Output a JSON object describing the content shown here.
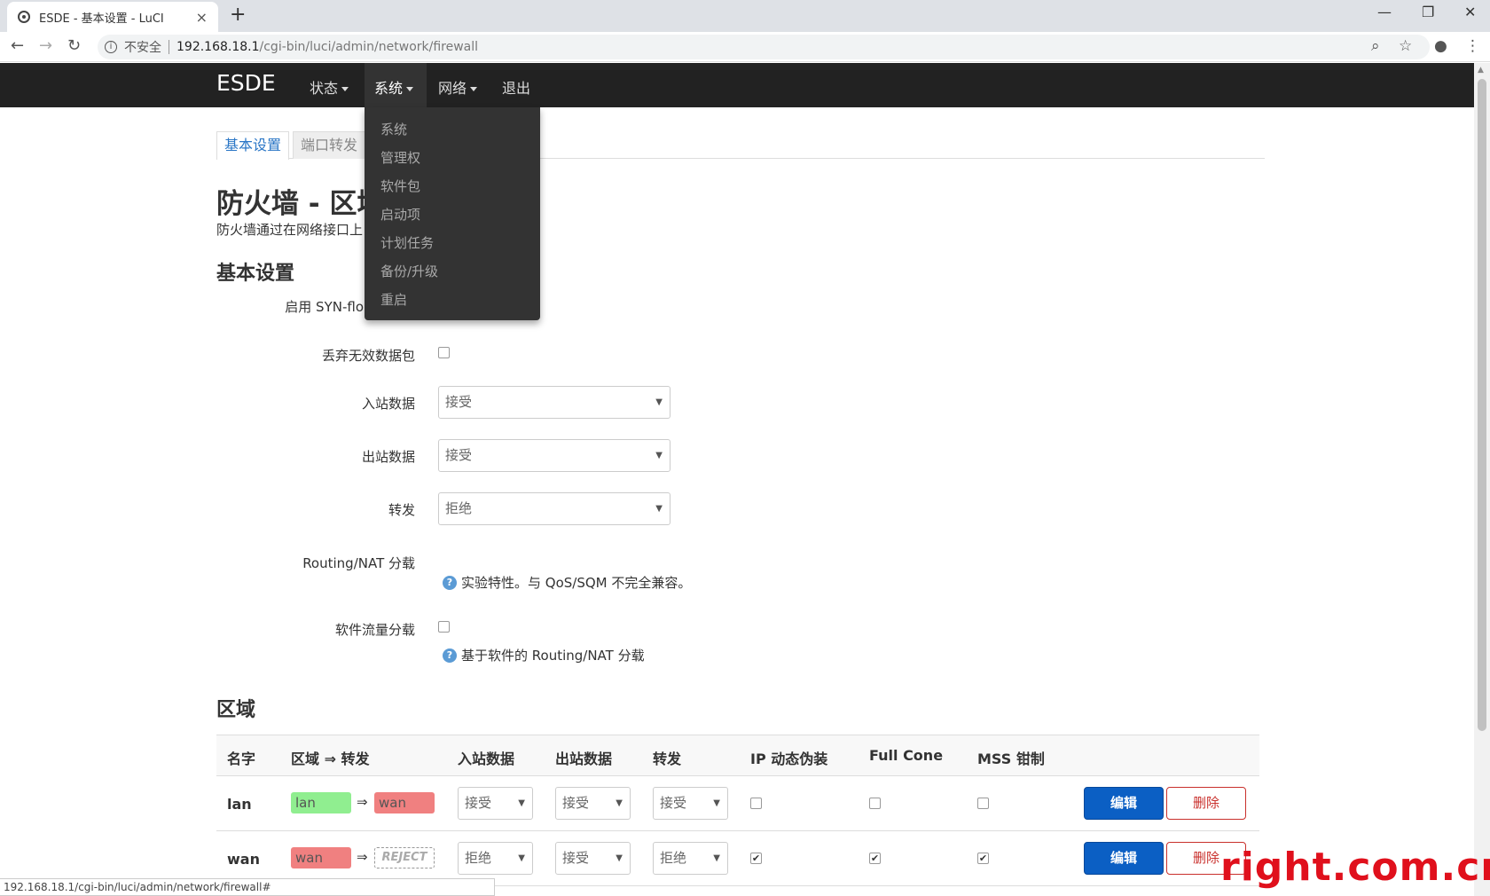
{
  "browser": {
    "tab_title": "ESDE - 基本设置 - LuCI",
    "tab_close": "×",
    "new_tab": "+",
    "insecure_label": "不安全",
    "url_host": "192.168.18.1",
    "url_path": "/cgi-bin/luci/admin/network/firewall",
    "status_url": "192.168.18.1/cgi-bin/luci/admin/network/firewall#"
  },
  "navbar": {
    "brand": "ESDE",
    "menus": [
      {
        "label": "状态"
      },
      {
        "label": "系统"
      },
      {
        "label": "网络"
      },
      {
        "label": "退出"
      }
    ],
    "dropdown": [
      "系统",
      "管理权",
      "软件包",
      "启动项",
      "计划任务",
      "备份/升级",
      "重启"
    ]
  },
  "page_tabs": [
    "基本设置",
    "端口转发"
  ],
  "title": "防火墙 - 区域",
  "description": "防火墙通过在网络接口上",
  "general": {
    "heading": "基本设置",
    "syn_flood_label": "启用 SYN-flo",
    "drop_invalid_label": "丢弃无效数据包",
    "input_label": "入站数据",
    "input_value": "接受",
    "output_label": "出站数据",
    "output_value": "接受",
    "forward_label": "转发",
    "forward_value": "拒绝",
    "offload_label": "Routing/NAT 分载",
    "offload_help": "实验特性。与 QoS/SQM 不完全兼容。",
    "sw_offload_label": "软件流量分载",
    "sw_offload_help": "基于软件的 Routing/NAT 分载"
  },
  "zones": {
    "heading": "区域",
    "columns": [
      "名字",
      "区域 ⇒ 转发",
      "入站数据",
      "出站数据",
      "转发",
      "IP 动态伪装",
      "Full Cone",
      "MSS 钳制"
    ],
    "arrow": "⇒",
    "rows": [
      {
        "name": "lan",
        "zone": "lan",
        "forward": "wan",
        "input": "接受",
        "output": "接受",
        "fwd": "接受",
        "masq": false,
        "fullcone": false,
        "mss": false,
        "edit": "编辑",
        "delete": "删除"
      },
      {
        "name": "wan",
        "zone": "wan",
        "forward": "REJECT",
        "input": "拒绝",
        "output": "接受",
        "fwd": "拒绝",
        "masq": true,
        "fullcone": true,
        "mss": true,
        "edit": "编辑",
        "delete": "删除"
      }
    ]
  },
  "colors": {
    "lan_zone": "#90ee90",
    "wan_zone": "#f08080",
    "edit_button": "#0b5fc4",
    "delete_button": "#c9302c",
    "navbar": "#222222",
    "watermark": "#e0101c"
  },
  "icons": {
    "help": "question-circle-icon",
    "checked": "checkmark-icon"
  },
  "watermark": "right.com.cn"
}
